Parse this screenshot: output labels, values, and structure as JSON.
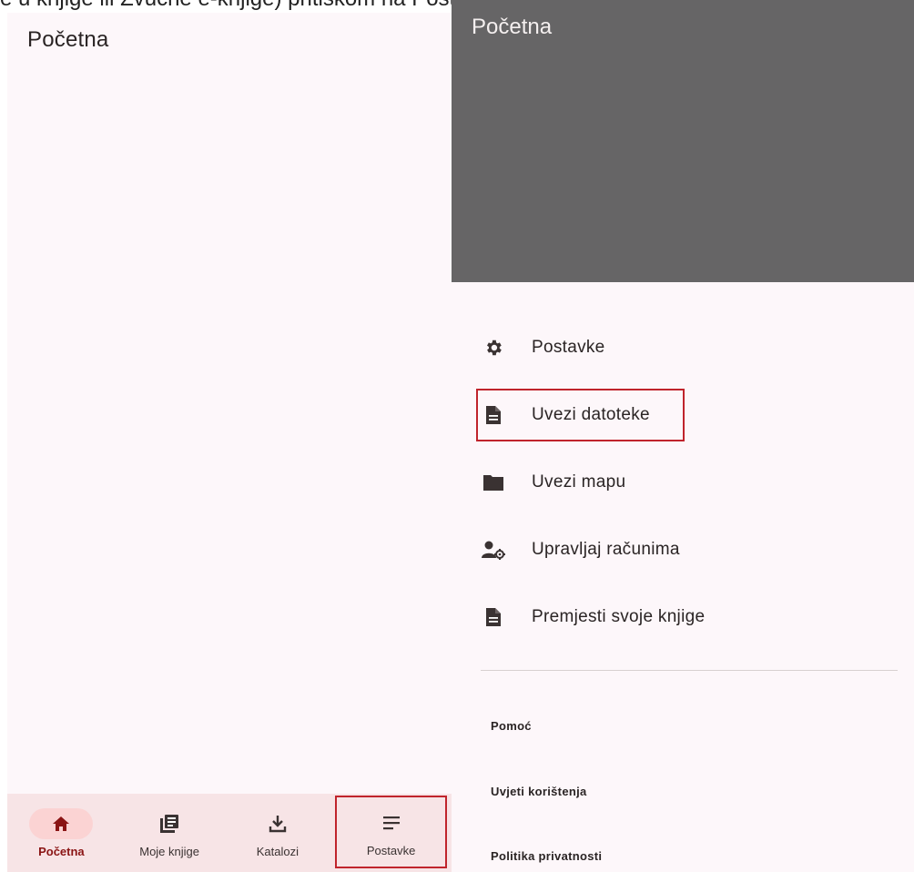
{
  "caption": {
    "text": "e u knjige ili Zvučne e-knjige) pritiskom na Postavke > Uvezi datoteke."
  },
  "left": {
    "title": "Početna",
    "bottom_nav": [
      {
        "label": "Početna",
        "icon": "home-icon",
        "active": true
      },
      {
        "label": "Moje knjige",
        "icon": "library-icon",
        "active": false
      },
      {
        "label": "Katalozi",
        "icon": "download-icon",
        "active": false
      },
      {
        "label": "Postavke",
        "icon": "menu-icon",
        "active": false,
        "highlighted": true
      }
    ]
  },
  "right": {
    "header_title": "Početna",
    "menu": [
      {
        "label": "Postavke",
        "icon": "gear-icon"
      },
      {
        "label": "Uvezi datoteke",
        "icon": "file-icon",
        "highlighted": true
      },
      {
        "label": "Uvezi mapu",
        "icon": "folder-icon"
      },
      {
        "label": "Upravljaj računima",
        "icon": "manage-accounts-icon"
      },
      {
        "label": "Premjesti svoje knjige",
        "icon": "file-icon"
      }
    ],
    "links": [
      {
        "label": "Pomoć"
      },
      {
        "label": "Uvjeti korištenja"
      },
      {
        "label": "Politika privatnosti"
      }
    ]
  },
  "colors": {
    "accent": "#8a1414",
    "highlight_border": "#c0242c",
    "header_gray": "#666566",
    "nav_bg": "#f7e4e6",
    "screen_bg": "#fdf7fa"
  }
}
